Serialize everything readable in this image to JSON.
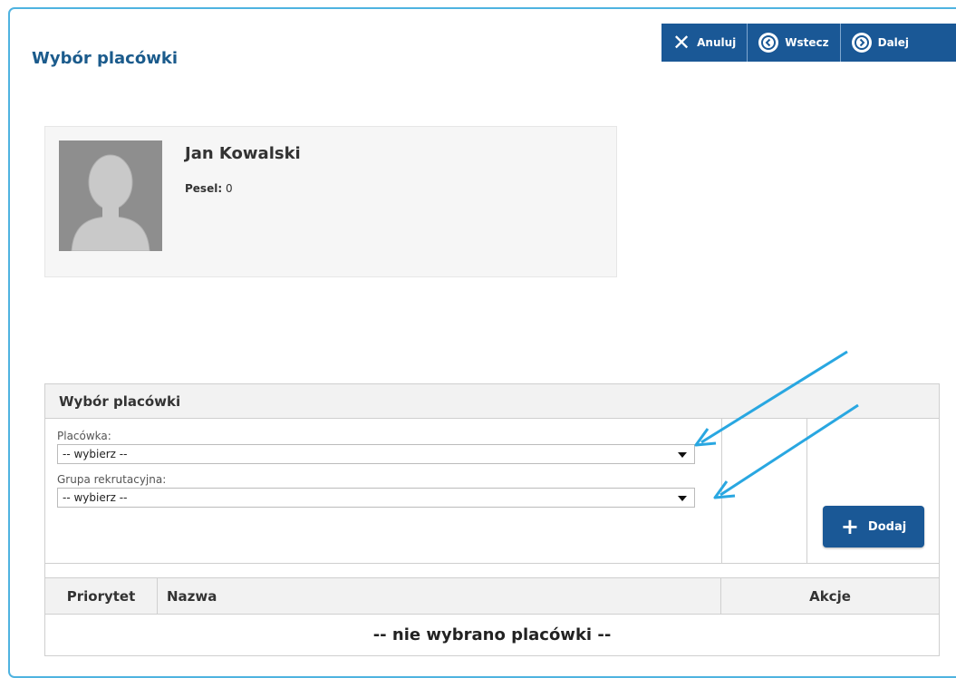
{
  "page": {
    "title": "Wybór placówki"
  },
  "toolbar": {
    "cancel_label": "Anuluj",
    "back_label": "Wstecz",
    "next_label": "Dalej"
  },
  "profile": {
    "name": "Jan Kowalski",
    "pesel_label": "Pesel:",
    "pesel_value": "0"
  },
  "panel": {
    "title": "Wybór placówki",
    "placowka_label": "Placówka:",
    "placowka_value": "-- wybierz --",
    "grupa_label": "Grupa rekrutacyjna:",
    "grupa_value": "-- wybierz --",
    "add_label": "Dodaj"
  },
  "table": {
    "headers": [
      "Priorytet",
      "Nazwa",
      "Akcje"
    ],
    "empty_message": "-- nie wybrano placówki --"
  },
  "colors": {
    "accent": "#1a5896",
    "frame": "#4fb3e0",
    "annotation_arrow": "#29a7e1"
  }
}
